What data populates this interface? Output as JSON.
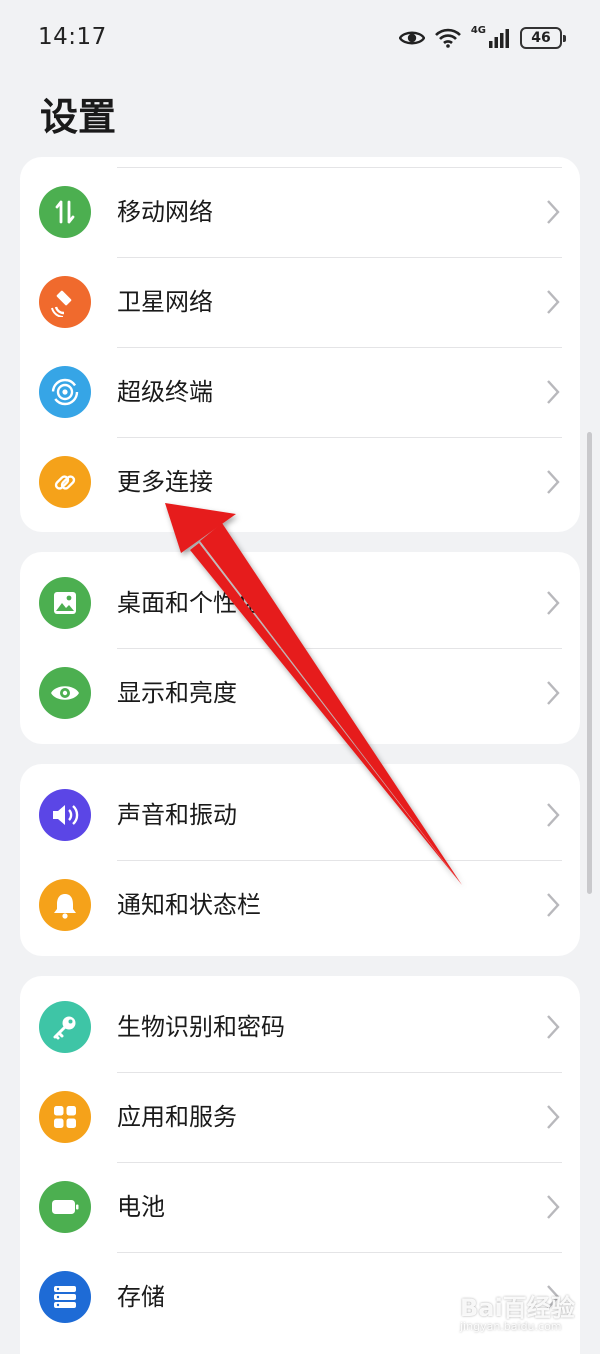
{
  "status_bar": {
    "time": "14:17",
    "network_type": "4G",
    "battery": "46"
  },
  "page": {
    "title": "设置"
  },
  "groups": [
    {
      "items": [
        {
          "label": "移动网络",
          "icon": "mobile-network-icon",
          "color": "#4caf50"
        },
        {
          "label": "卫星网络",
          "icon": "satellite-icon",
          "color": "#f06a2d"
        },
        {
          "label": "超级终端",
          "icon": "super-device-icon",
          "color": "#36a5e6"
        },
        {
          "label": "更多连接",
          "icon": "link-icon",
          "color": "#f5a21a"
        }
      ]
    },
    {
      "items": [
        {
          "label": "桌面和个性化",
          "icon": "wallpaper-icon",
          "color": "#4caf50"
        },
        {
          "label": "显示和亮度",
          "icon": "eye-icon",
          "color": "#4caf50"
        }
      ]
    },
    {
      "items": [
        {
          "label": "声音和振动",
          "icon": "speaker-icon",
          "color": "#5b46e6"
        },
        {
          "label": "通知和状态栏",
          "icon": "bell-icon",
          "color": "#f5a21a"
        }
      ]
    },
    {
      "items": [
        {
          "label": "生物识别和密码",
          "icon": "key-icon",
          "color": "#3ec5a6"
        },
        {
          "label": "应用和服务",
          "icon": "apps-icon",
          "color": "#f5a21a"
        },
        {
          "label": "电池",
          "icon": "battery-icon",
          "color": "#4caf50"
        },
        {
          "label": "存储",
          "icon": "storage-icon",
          "color": "#1e6bd6"
        }
      ]
    }
  ],
  "annotation": {
    "arrow_color": "#e61e1e"
  },
  "watermark": {
    "text": "Bai百经验",
    "sub": "jingyan.baidu.com"
  }
}
